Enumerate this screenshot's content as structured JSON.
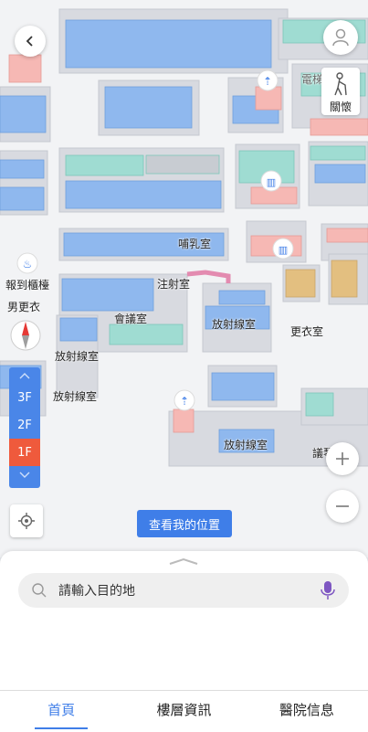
{
  "map": {
    "room_labels": {
      "elevator": "電梯",
      "nursing_room": "哺乳室",
      "injection_room": "注射室",
      "meeting_room": "會議室",
      "radiology_1": "放射線室",
      "radiology_2": "放射線室",
      "radiology_3": "放射線室",
      "radiology_4": "放射線室",
      "locker_room": "更衣室",
      "mens_locker": "男更衣",
      "registration": "報到櫃檯",
      "partial": "議琴"
    }
  },
  "care_mode": {
    "label": "關懷",
    "icon": "elderly-person-icon"
  },
  "floors": {
    "items": [
      "3F",
      "2F",
      "1F"
    ],
    "active": "1F"
  },
  "my_location_button": {
    "label": "查看我的位置"
  },
  "search": {
    "placeholder": "請輸入目的地"
  },
  "tabs": [
    {
      "label": "首頁",
      "active": true
    },
    {
      "label": "樓層資訊",
      "active": false
    },
    {
      "label": "醫院信息",
      "active": false
    }
  ],
  "colors": {
    "accent": "#3f7ee8",
    "active_floor": "#ef5a3c",
    "room_blue": "#8fb8ee",
    "room_teal": "#9fdcd2",
    "room_pink": "#f6b8b4"
  }
}
